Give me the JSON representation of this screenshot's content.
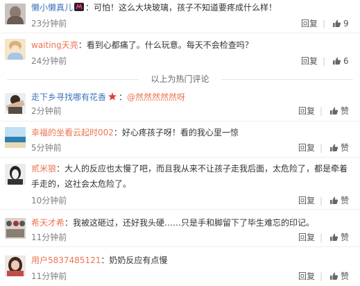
{
  "comments": [
    {
      "user": "懒小懒真儿",
      "text": "：可怕！这么大块玻璃，孩子不知道要疼成什么样！",
      "time": "23分钟前",
      "reply": "回复",
      "likes": "9"
    },
    {
      "user": "waiting天亮",
      "text": "：看到心都痛了。什么玩意。每天不会检查吗？",
      "time": "24分钟前",
      "reply": "回复",
      "likes": "6"
    },
    {
      "user": "走下乡寻找哪有花香",
      "mention": "@然然然然然呀",
      "text": "：",
      "time": "2分钟前",
      "reply": "回复",
      "likes": "赞"
    },
    {
      "user": "幸福的坐看云起时002",
      "text": "：好心疼孩子呀！看的我心里一惊",
      "time": "5分钟前",
      "reply": "回复",
      "likes": "赞"
    },
    {
      "user": "贰米狼",
      "text": "：大人的反应也太慢了吧，而且我从来不让孩子走我后面，太危险了，都是牵着",
      "text2": "手走的，这社会太危险了。",
      "time": "10分钟前",
      "reply": "回复",
      "likes": "赞"
    },
    {
      "user": "希天才希",
      "text": "：我被这砸过，还好我头硬……只是手和脚留下了毕生难忘的印记。",
      "time": "11分钟前",
      "reply": "回复",
      "likes": "赞"
    },
    {
      "user": "用户5837485121",
      "text": "：奶奶反应有点慢",
      "time": "11分钟前",
      "reply": "回复",
      "likes": "赞"
    }
  ],
  "hot_divider": "以上为热门评论",
  "colors": {
    "username": "#eb7350",
    "blue_username": "#3b73b9",
    "time": "#808080"
  }
}
